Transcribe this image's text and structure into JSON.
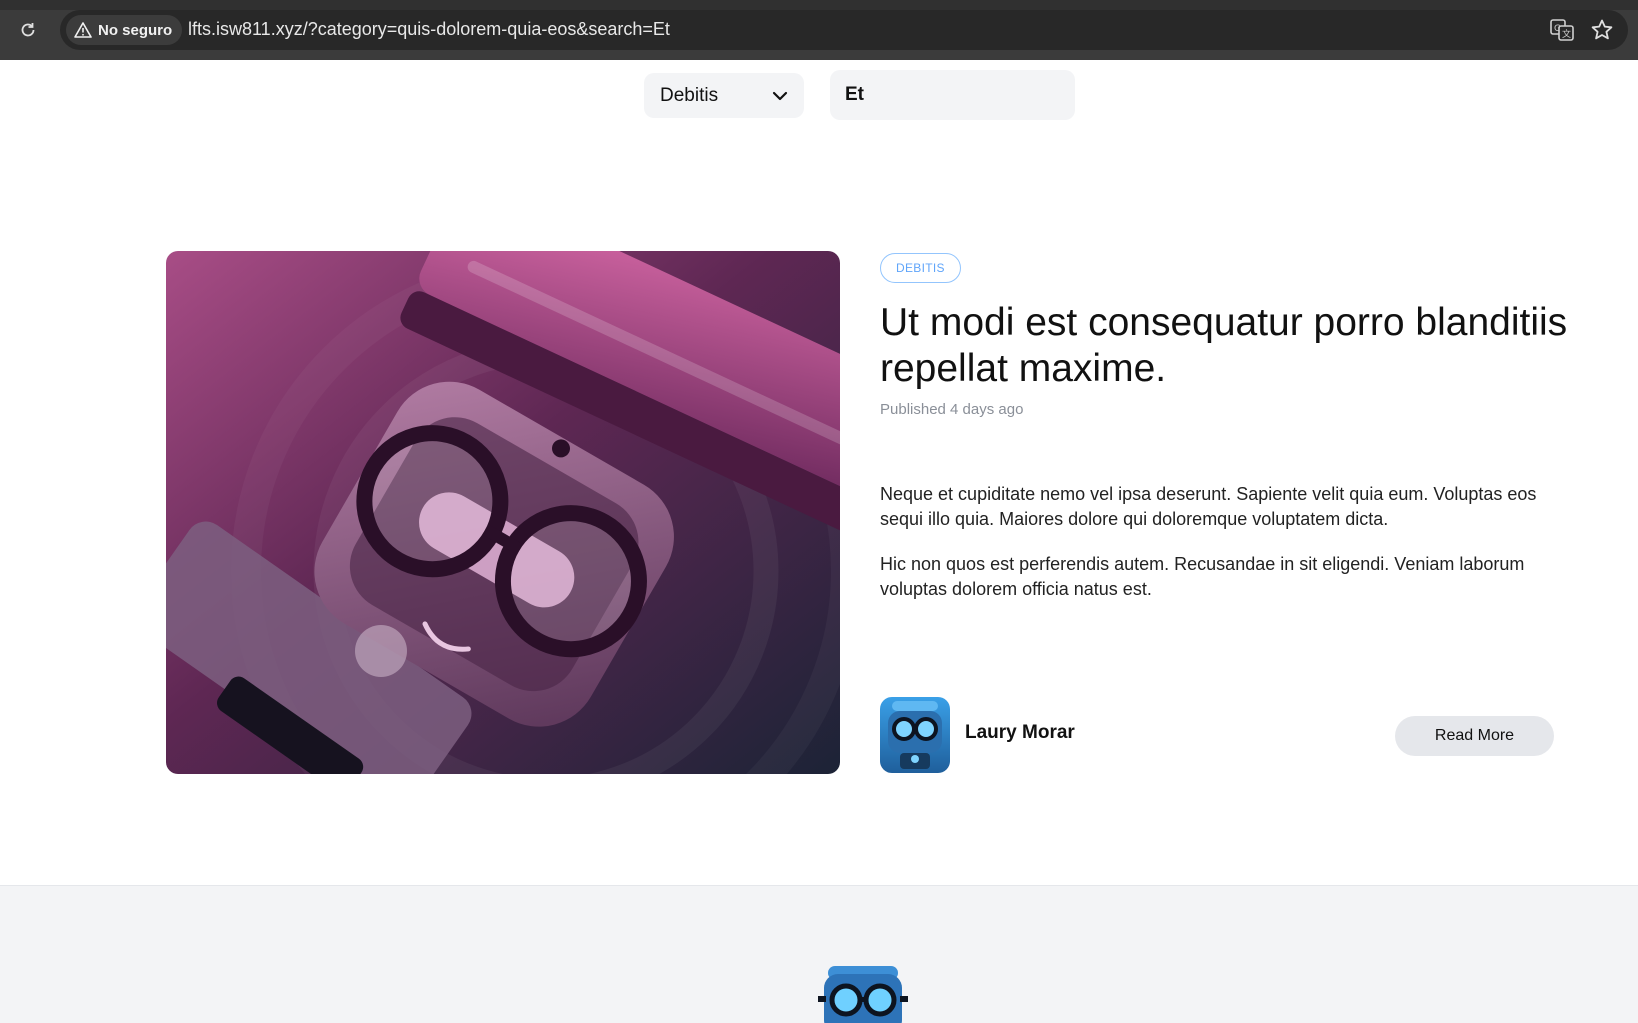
{
  "browser": {
    "security_label": "No seguro",
    "url": "lfts.isw811.xyz/?category=quis-dolorem-quia-eos&search=Et",
    "icons": [
      "reload-icon",
      "warning-icon",
      "translate-icon",
      "star-icon"
    ]
  },
  "filters": {
    "category_selected": "Debitis",
    "search_value": "Et"
  },
  "post": {
    "category_tag": "DEBITIS",
    "title": "Ut modi est consequatur porro blanditiis repellat maxime.",
    "published": "Published 4 days ago",
    "paragraphs": [
      "Neque et cupiditate nemo vel ipsa deserunt. Sapiente velit quia eum. Voluptas eos sequi illo quia. Maiores dolore qui doloremque voluptatem dicta.",
      "Hic non quos est perferendis autem. Recusandae in sit eligendi. Veniam laborum voluptas dolorem officia natus est."
    ],
    "author": "Laury Morar",
    "read_more": "Read More"
  },
  "colors": {
    "chrome_bg": "#3b3b3b",
    "urlbar_bg": "#282828",
    "input_bg": "#f3f4f6",
    "tag_border": "#93c5fd",
    "tag_text": "#60a5fa",
    "button_bg": "#e5e7eb",
    "footer_bg": "#f3f4f6"
  }
}
